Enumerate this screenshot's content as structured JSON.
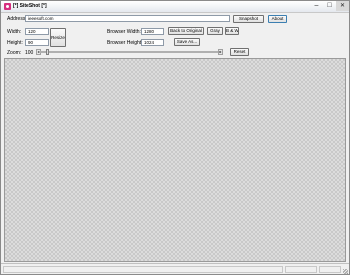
{
  "window": {
    "title": "[*] SiteShot [*]",
    "minimize_glyph": "–",
    "maximize_glyph": "□",
    "close_glyph": "✕"
  },
  "address": {
    "label": "Address:",
    "value": "ieeesoft.com",
    "snapshot_label": "Snapshot",
    "about_label": "About"
  },
  "size": {
    "width_label": "Width:",
    "width_value": "120",
    "height_label": "Height:",
    "height_value": "90",
    "resize_label": "Resize"
  },
  "browser": {
    "width_label": "Browser Width:",
    "width_value": "1280",
    "height_label": "Browser Height:",
    "height_value": "1024",
    "back_label": "Back to Original",
    "gray_label": "Gray",
    "bw_label": "B & W",
    "save_label": "Save As..."
  },
  "zoom": {
    "label": "Zoom:",
    "value": "100",
    "level_percent": 3,
    "left_arrow": "◂",
    "right_arrow": "▸",
    "reset_label": "Reset"
  },
  "colors": {
    "window_bg": "#f0f0f0",
    "canvas_check_light": "#dcdcdc",
    "canvas_check_dark": "#c9c9c9",
    "app_icon": "#d62f7f"
  }
}
